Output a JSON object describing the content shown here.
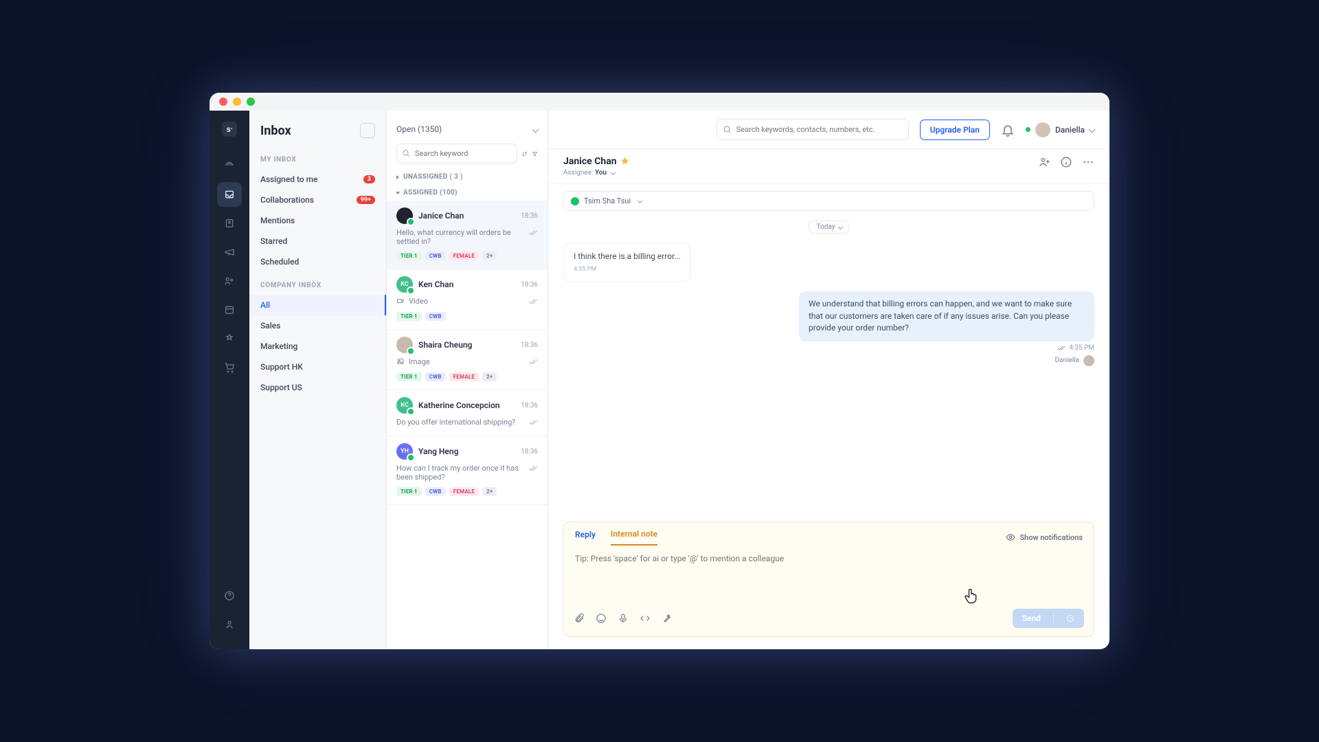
{
  "sidebar": {
    "title": "Inbox",
    "section_my": "MY INBOX",
    "section_company": "COMPANY INBOX",
    "my_items": [
      {
        "label": "Assigned to me",
        "badge": "3"
      },
      {
        "label": "Collaborations",
        "badge": "99+"
      },
      {
        "label": "Mentions"
      },
      {
        "label": "Starred"
      },
      {
        "label": "Scheduled"
      }
    ],
    "company_items": [
      {
        "label": "All",
        "active": true
      },
      {
        "label": "Sales"
      },
      {
        "label": "Marketing"
      },
      {
        "label": "Support HK"
      },
      {
        "label": "Support US"
      }
    ]
  },
  "convlist": {
    "status_label": "Open (1350)",
    "search_placeholder": "Search keyword",
    "group_unassigned": "UNASSIGNED ( 3 )",
    "group_assigned": "ASSIGNED (100)",
    "items": [
      {
        "avatar_bg": "#1f2430",
        "initials": "",
        "name": "Janice Chan",
        "time": "18:36",
        "preview": "Hello, what currency will orders be settled in?",
        "chips": [
          "TIER 1",
          "CWB",
          "FEMALE",
          "2+"
        ],
        "selected": true
      },
      {
        "avatar_bg": "#3fc08c",
        "initials": "KC",
        "name": "Ken Chan",
        "time": "18:36",
        "preview": "Video",
        "icon": "video",
        "chips": [
          "TIER 1",
          "CWB"
        ]
      },
      {
        "avatar_bg": "#c6b9ad",
        "initials": "",
        "name": "Shaira Cheung",
        "time": "18:36",
        "preview": "Image",
        "icon": "image",
        "chips": [
          "TIER 1",
          "CWB",
          "FEMALE",
          "2+"
        ]
      },
      {
        "avatar_bg": "#3fc08c",
        "initials": "KC",
        "name": "Katherine Concepcion",
        "time": "18:36",
        "preview": "Do you offer international shipping?",
        "chips": []
      },
      {
        "avatar_bg": "#6a6ff0",
        "initials": "YH",
        "name": "Yang Heng",
        "time": "18:36",
        "preview": "How can I track my order once it has been shipped?",
        "chips": [
          "TIER 1",
          "CWB",
          "FEMALE",
          "2+"
        ]
      }
    ]
  },
  "topbar": {
    "search_placeholder": "Search keywords, contacts, numbers, etc.",
    "upgrade_label": "Upgrade Plan",
    "user_name": "Daniella"
  },
  "conversation": {
    "name": "Janice Chan",
    "assignee_label": "Assignee:",
    "assignee_value": "You",
    "location": "Tsim Sha Tsui",
    "day_sep": "Today",
    "msg_in_text": "I think there is a billing error...",
    "msg_in_ts": "4:35 PM",
    "msg_out_text": "We understand that billing errors can happen, and we want to make sure that our customers are taken care of if any issues arise. Can you please provide your order number?",
    "msg_out_ts": "4:35 PM",
    "msg_out_from": "Daniella"
  },
  "composer": {
    "tab_reply": "Reply",
    "tab_note": "Internal note",
    "show_notifications": "Show notifications",
    "placeholder": "Tip: Press 'space' for ai or type '@' to mention a colleague",
    "send_label": "Send"
  }
}
